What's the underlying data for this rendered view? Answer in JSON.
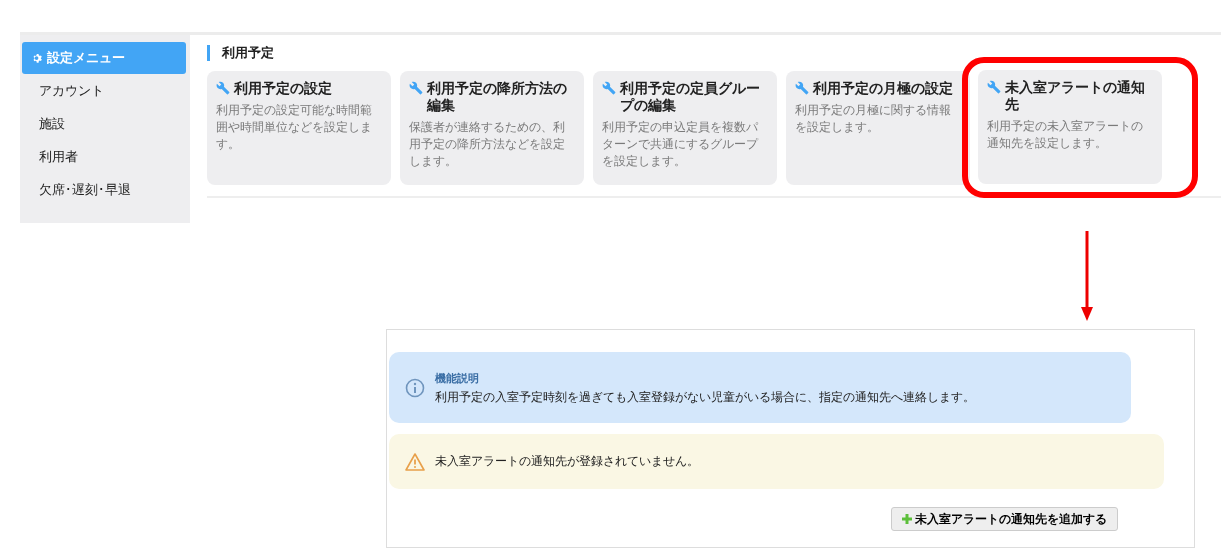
{
  "sidebar": {
    "header": "設定メニュー",
    "items": [
      {
        "label": "アカウント",
        "selected": false
      },
      {
        "label": "施設",
        "selected": false
      },
      {
        "label": "利用者",
        "selected": false
      },
      {
        "label": "欠席･遅刻･早退",
        "selected": false
      }
    ]
  },
  "section": {
    "title": "利用予定",
    "cards": [
      {
        "title": "利用予定の設定",
        "description": "利用予定の設定可能な時間範囲や時間単位などを設定します。",
        "highlighted": false
      },
      {
        "title": "利用予定の降所方法の編集",
        "description": "保護者が連絡するための、利用予定の降所方法などを設定します。",
        "highlighted": false
      },
      {
        "title": "利用予定の定員グループの編集",
        "description": "利用予定の申込定員を複数パターンで共通にするグループを設定します。",
        "highlighted": false
      },
      {
        "title": "利用予定の月極の設定",
        "description": "利用予定の月極に関する情報を設定します。",
        "highlighted": false
      },
      {
        "title": "未入室アラートの通知先",
        "description": "利用予定の未入室アラートの通知先を設定します。",
        "highlighted": true
      }
    ]
  },
  "detail": {
    "info": {
      "title": "機能説明",
      "text": "利用予定の入室予定時刻を過ぎても入室登録がない児童がいる場合に、指定の通知先へ連絡します。"
    },
    "warning": {
      "text": "未入室アラートの通知先が登録されていません。"
    },
    "add_button": "未入室アラートの通知先を追加する"
  }
}
